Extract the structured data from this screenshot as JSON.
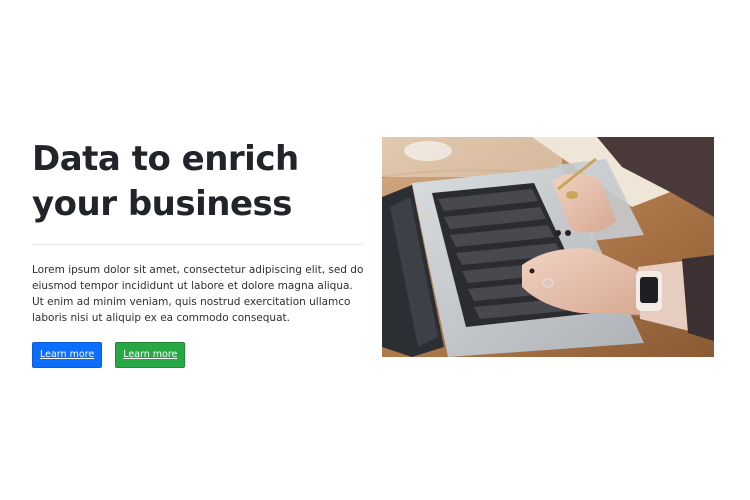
{
  "hero": {
    "title": "Data to enrich your business",
    "body": "Lorem ipsum dolor sit amet, consectetur adipiscing elit, sed do eiusmod tempor incididunt ut labore et dolore magna aliqua. Ut enim ad minim veniam, quis nostrud exercitation ullamco laboris nisi ut aliquip ex ea commodo consequat.",
    "primary_button_label": "Learn more",
    "secondary_button_label": "Learn more"
  },
  "colors": {
    "primary": "#0d6efd",
    "success": "#28a745",
    "heading": "#212529"
  },
  "image": {
    "icon": "laptop-photo"
  }
}
